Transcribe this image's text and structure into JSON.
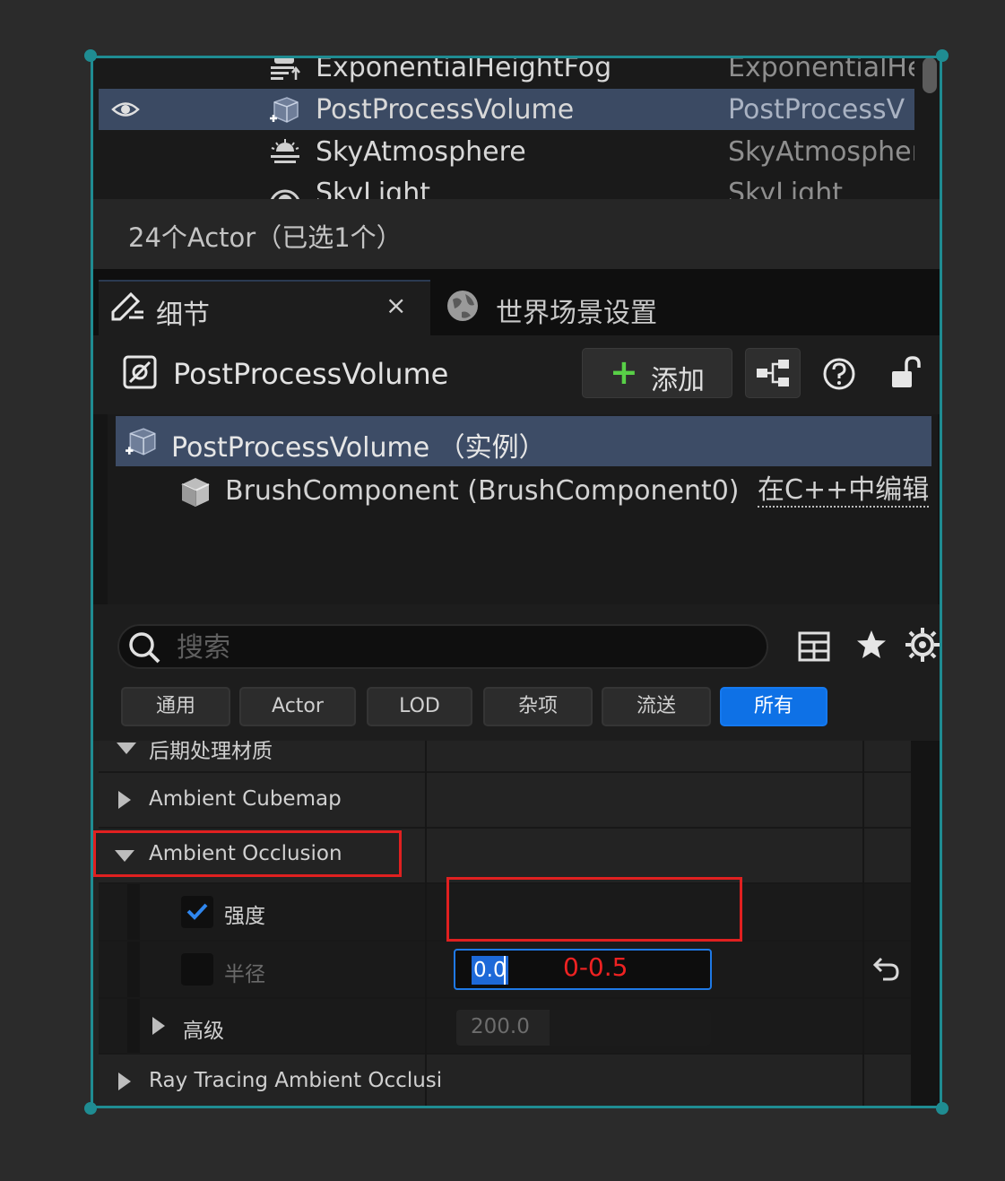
{
  "outliner": {
    "rows": [
      {
        "name": "ExponentialHeightFog",
        "type": "ExponentialHe"
      },
      {
        "name": "PostProcessVolume",
        "type": "PostProcessV"
      },
      {
        "name": "SkyAtmosphere",
        "type": "SkyAtmospher"
      },
      {
        "name": "SkyLight",
        "type": "SkyLight"
      }
    ],
    "status": "24个Actor（已选1个）"
  },
  "tabs": {
    "details": "细节",
    "close": "×",
    "world": "世界场景设置"
  },
  "details": {
    "actor_name": "PostProcessVolume",
    "add_label": "添加",
    "add_plus": "+",
    "components": {
      "root": "PostProcessVolume （实例）",
      "child": "BrushComponent (BrushComponent0)",
      "edit_link": "在C++中编辑"
    },
    "search": {
      "placeholder": "搜索"
    },
    "filters": [
      "通用",
      "Actor",
      "LOD",
      "杂项",
      "流送",
      "所有"
    ],
    "active_filter": "所有"
  },
  "properties": {
    "top_partial": "后期处理材质",
    "ambient_cubemap": "Ambient Cubemap",
    "ambient_occlusion": "Ambient Occlusion",
    "intensity": {
      "label": "强度",
      "checked": true,
      "value": "0.0",
      "annotation": "0-0.5"
    },
    "radius": {
      "label": "半径",
      "checked": false,
      "value": "200.0"
    },
    "advanced": "高级",
    "ray_tracing": "Ray Tracing Ambient Occlusi"
  },
  "colors": {
    "selection_border": "#1f8c92",
    "selected_row": "#3b4a63",
    "accent_blue": "#0e71e6",
    "add_green": "#58d047",
    "annotation_red": "#e02020"
  },
  "icons": [
    "eye-icon",
    "fog-icon",
    "post-process-volume-icon",
    "sky-atmosphere-icon",
    "skylight-icon",
    "details-edit-icon",
    "world-settings-icon",
    "actor-icon",
    "blueprint-icon",
    "help-icon",
    "lock-icon",
    "brush-component-icon",
    "search-icon",
    "grid-icon",
    "star-icon",
    "gear-icon",
    "reset-arrow-icon",
    "checkmark-icon"
  ]
}
